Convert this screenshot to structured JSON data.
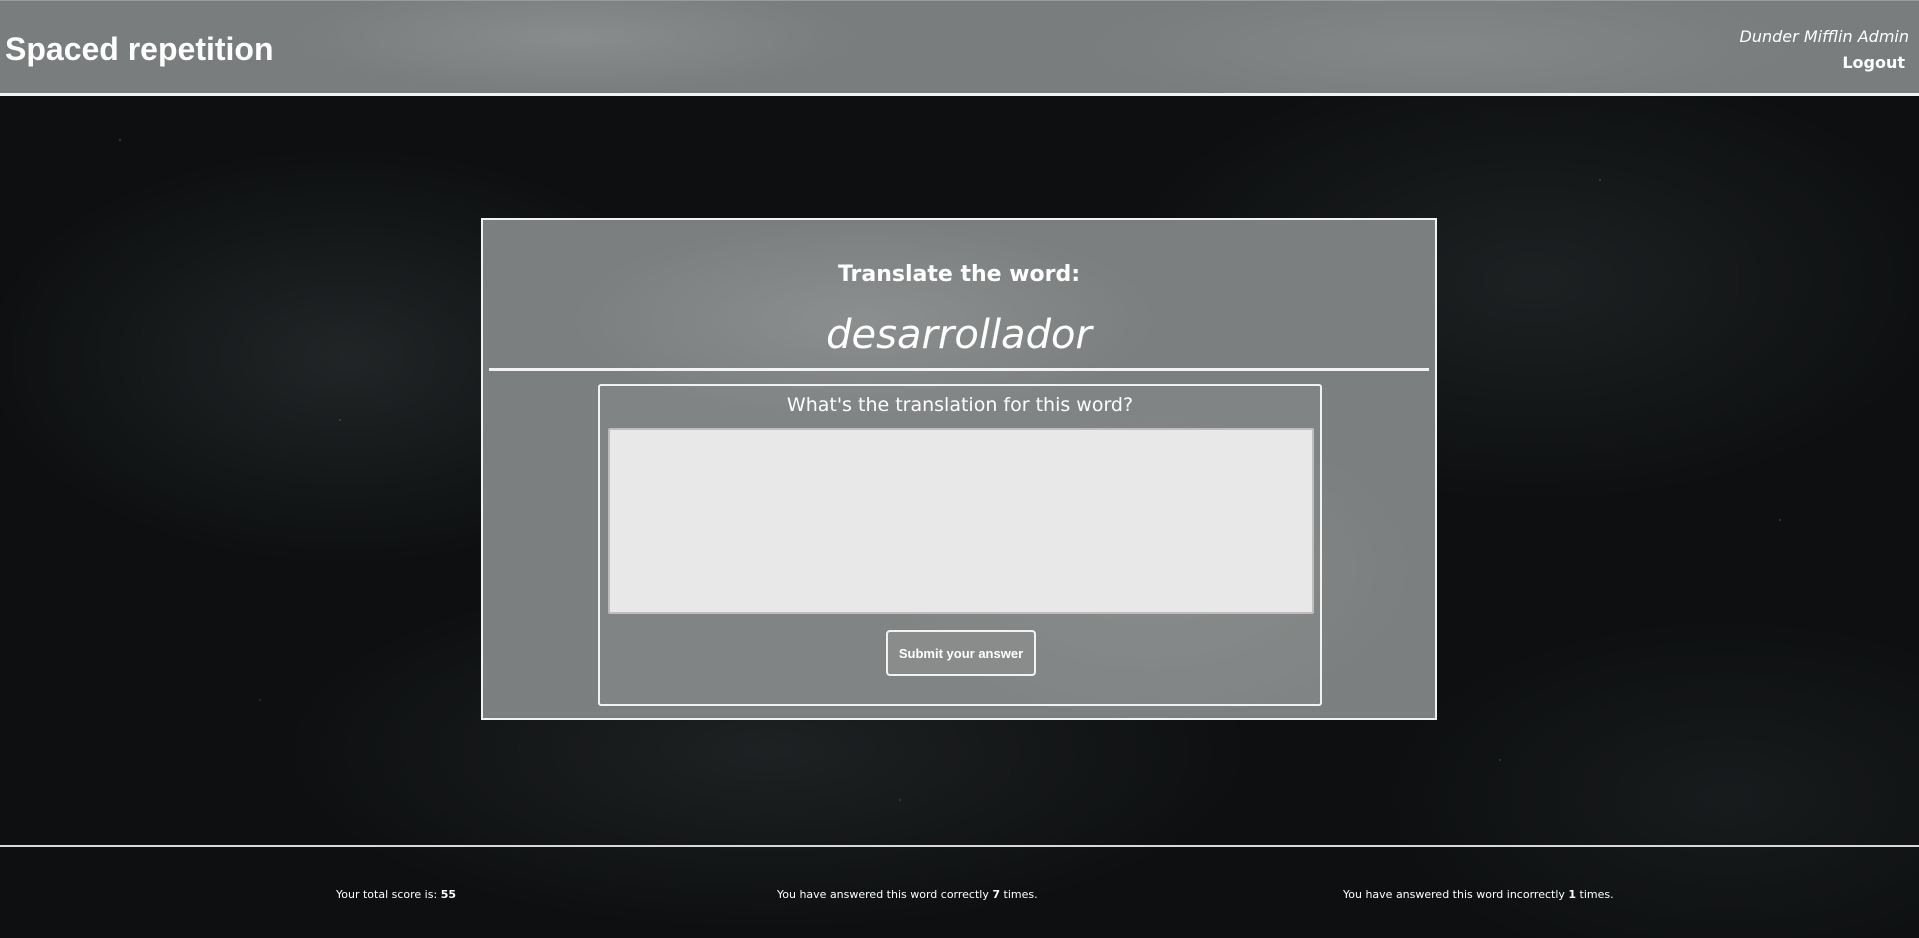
{
  "header": {
    "title": "Spaced repetition",
    "user_name": "Dunder Mifflin Admin",
    "logout_label": "Logout"
  },
  "card": {
    "heading": "Translate the word:",
    "word": "desarrollador",
    "question": "What's the translation for this word?",
    "answer_value": "",
    "submit_label": "Submit your answer"
  },
  "footer": {
    "score_prefix": "Your total score is:",
    "score_value": "55",
    "correct_prefix": "You have answered this word correctly",
    "correct_count": "7",
    "correct_suffix": "times.",
    "incorrect_prefix": "You have answered this word incorrectly",
    "incorrect_count": "1",
    "incorrect_suffix": "times."
  },
  "colors": {
    "background": "#0d0f10",
    "panel": "#7c7f7f",
    "border": "#f2f2f2",
    "input_bg": "#e8e8e8"
  }
}
